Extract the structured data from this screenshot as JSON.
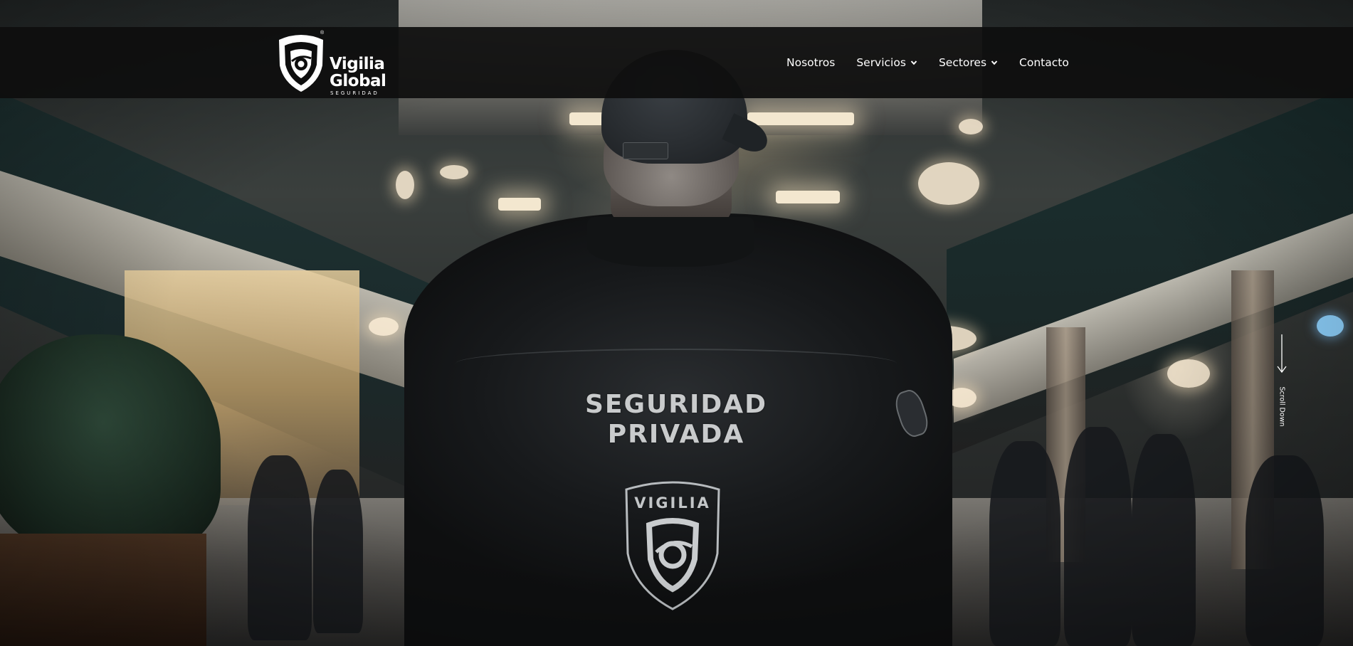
{
  "brand": {
    "name_line1": "Vigilia",
    "name_line2": "Global",
    "tagline": "SEGURIDAD",
    "registered_mark": "®"
  },
  "nav": {
    "items": [
      {
        "label": "Nosotros",
        "has_dropdown": false
      },
      {
        "label": "Servicios",
        "has_dropdown": true
      },
      {
        "label": "Sectores",
        "has_dropdown": true
      },
      {
        "label": "Contacto",
        "has_dropdown": false
      }
    ]
  },
  "hero": {
    "jacket_line1": "SEGURIDAD",
    "jacket_line2": "PRIVADA",
    "jacket_badge_text": "VIGILIA"
  },
  "scroll": {
    "label": "Scroll Down"
  },
  "colors": {
    "header_bg": "#0e0e0e",
    "nav_text": "#ffffff",
    "hero_dark": "#17191b",
    "accent_light": "#c9cbcc"
  },
  "icons": {
    "logo": "shield-eye-icon",
    "dropdown": "chevron-down-icon",
    "scroll": "arrow-down-icon"
  }
}
